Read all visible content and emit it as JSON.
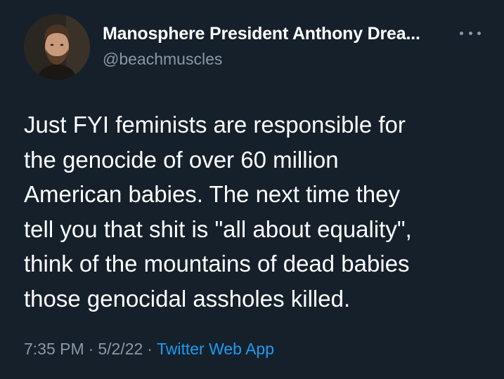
{
  "tweet": {
    "author": {
      "display_name": "Manosphere President Anthony Drea...",
      "handle": "@beachmuscles",
      "avatar": "profile-photo"
    },
    "more_icon": "more-horizontal-icon",
    "text_lines": [
      "Just FYI feminists are responsible for",
      "the genocide of over 60 million",
      "American babies. The next time they",
      "tell you that shit is \"all about equality\",",
      "think of the mountains of dead babies",
      "those genocidal assholes killed."
    ],
    "time": "7:35 PM",
    "date": "5/2/22",
    "separator": "·",
    "source": "Twitter Web App"
  },
  "colors": {
    "background": "#15202b",
    "primary_text": "#ffffff",
    "secondary_text": "#8b98a5",
    "link": "#1d9bf0"
  }
}
